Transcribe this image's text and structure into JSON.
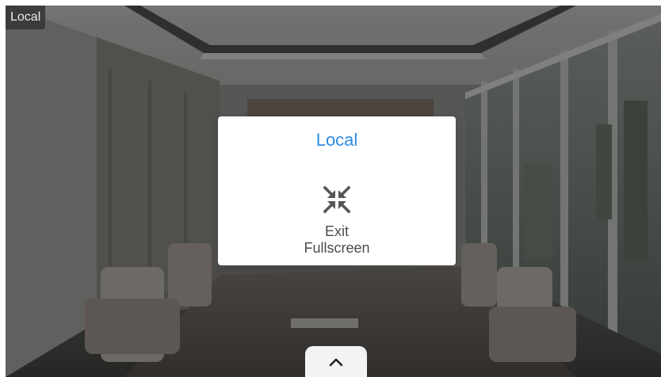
{
  "video": {
    "source_label": "Local"
  },
  "dialog": {
    "title": "Local",
    "exit_button": {
      "icon": "exit-fullscreen-icon",
      "label_line1": "Exit",
      "label_line2": "Fullscreen"
    }
  },
  "bottom_tab": {
    "icon": "chevron-up-icon"
  },
  "colors": {
    "title_accent": "#2f8be0",
    "label_text": "#4a4a4a",
    "dialog_bg": "#ffffff"
  }
}
